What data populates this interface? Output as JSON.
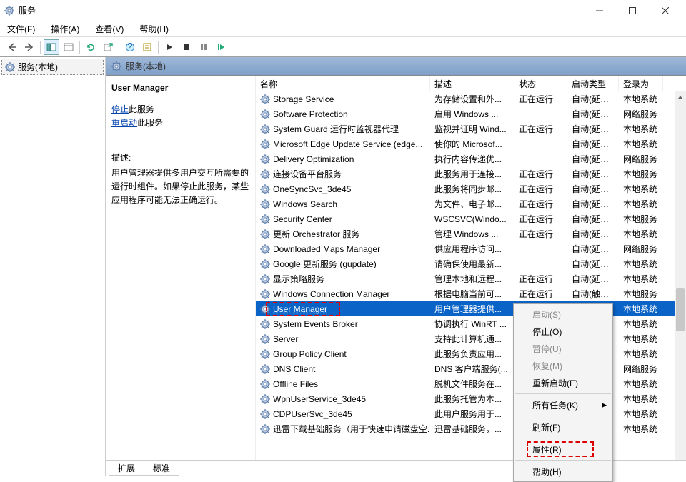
{
  "window": {
    "title": "服务"
  },
  "menu": {
    "file": "文件(F)",
    "action": "操作(A)",
    "view": "查看(V)",
    "help": "帮助(H)"
  },
  "tree": {
    "root": "服务(本地)"
  },
  "right_header": "服务(本地)",
  "detail": {
    "title": "User Manager",
    "stop_link": "停止",
    "stop_suffix": "此服务",
    "restart_link": "重启动",
    "restart_suffix": "此服务",
    "desc_label": "描述:",
    "desc": "用户管理器提供多用户交互所需要的运行时组件。如果停止此服务，某些应用程序可能无法正确运行。"
  },
  "columns": {
    "name": "名称",
    "desc": "描述",
    "status": "状态",
    "startup": "启动类型",
    "logon": "登录为"
  },
  "rows": [
    {
      "name": "Storage Service",
      "desc": "为存储设置和外...",
      "status": "正在运行",
      "startup": "自动(延迟...",
      "logon": "本地系统"
    },
    {
      "name": "Software Protection",
      "desc": "启用 Windows ...",
      "status": "",
      "startup": "自动(延迟...",
      "logon": "网络服务"
    },
    {
      "name": "System Guard 运行时监视器代理",
      "desc": "监视并证明 Wind...",
      "status": "正在运行",
      "startup": "自动(延迟...",
      "logon": "本地系统"
    },
    {
      "name": "Microsoft Edge Update Service (edge...",
      "desc": "使你的 Microsof...",
      "status": "",
      "startup": "自动(延迟...",
      "logon": "本地系统"
    },
    {
      "name": "Delivery Optimization",
      "desc": "执行内容传递优...",
      "status": "",
      "startup": "自动(延迟...",
      "logon": "网络服务"
    },
    {
      "name": "连接设备平台服务",
      "desc": "此服务用于连接...",
      "status": "正在运行",
      "startup": "自动(延迟...",
      "logon": "本地服务"
    },
    {
      "name": "OneSyncSvc_3de45",
      "desc": "此服务将同步邮...",
      "status": "正在运行",
      "startup": "自动(延迟...",
      "logon": "本地系统"
    },
    {
      "name": "Windows Search",
      "desc": "为文件、电子邮...",
      "status": "正在运行",
      "startup": "自动(延迟...",
      "logon": "本地系统"
    },
    {
      "name": "Security Center",
      "desc": "WSCSVC(Windo...",
      "status": "正在运行",
      "startup": "自动(延迟...",
      "logon": "本地服务"
    },
    {
      "name": "更新 Orchestrator 服务",
      "desc": "管理 Windows ...",
      "status": "正在运行",
      "startup": "自动(延迟...",
      "logon": "本地系统"
    },
    {
      "name": "Downloaded Maps Manager",
      "desc": "供应用程序访问...",
      "status": "",
      "startup": "自动(延迟...",
      "logon": "网络服务"
    },
    {
      "name": "Google 更新服务 (gupdate)",
      "desc": "请确保使用最新...",
      "status": "",
      "startup": "自动(延迟...",
      "logon": "本地系统"
    },
    {
      "name": "显示策略服务",
      "desc": "管理本地和远程...",
      "status": "正在运行",
      "startup": "自动(延迟...",
      "logon": "本地系统"
    },
    {
      "name": "Windows Connection Manager",
      "desc": "根据电脑当前可...",
      "status": "正在运行",
      "startup": "自动(触发...",
      "logon": "本地服务"
    },
    {
      "name": "User Manager",
      "desc": "用户管理器提供...",
      "status": "",
      "startup": "",
      "logon": "本地系统",
      "selected": true
    },
    {
      "name": "System Events Broker",
      "desc": "协调执行 WinRT ...",
      "status": "",
      "startup": "",
      "logon": "本地系统"
    },
    {
      "name": "Server",
      "desc": "支持此计算机通...",
      "status": "",
      "startup": "",
      "logon": "本地系统"
    },
    {
      "name": "Group Policy Client",
      "desc": "此服务负责应用...",
      "status": "",
      "startup": "",
      "logon": "本地系统"
    },
    {
      "name": "DNS Client",
      "desc": "DNS 客户端服务(...",
      "status": "",
      "startup": "",
      "logon": "网络服务"
    },
    {
      "name": "Offline Files",
      "desc": "脱机文件服务在...",
      "status": "",
      "startup": "",
      "logon": "本地系统"
    },
    {
      "name": "WpnUserService_3de45",
      "desc": "此服务托管为本...",
      "status": "",
      "startup": "",
      "logon": "本地系统"
    },
    {
      "name": "CDPUserSvc_3de45",
      "desc": "此用户服务用于...",
      "status": "",
      "startup": "",
      "logon": "本地系统"
    },
    {
      "name": "迅雷下载基础服务（用于快速申请磁盘空...",
      "desc": "迅雷基础服务，...",
      "status": "",
      "startup": "",
      "logon": "本地系统"
    }
  ],
  "ctx": {
    "start": "启动(S)",
    "stop": "停止(O)",
    "pause": "暂停(U)",
    "resume": "恢复(M)",
    "restart": "重新启动(E)",
    "alltasks": "所有任务(K)",
    "refresh": "刷新(F)",
    "props": "属性(R)",
    "help": "帮助(H)"
  },
  "tabs": {
    "extended": "扩展",
    "standard": "标准"
  }
}
